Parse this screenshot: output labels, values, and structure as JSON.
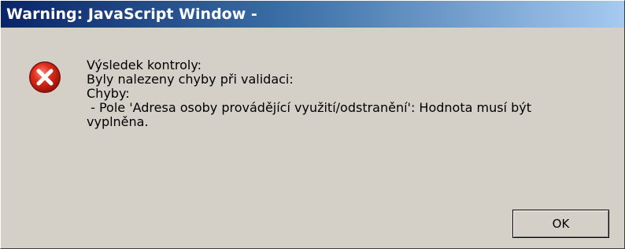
{
  "window": {
    "title": "Warning: JavaScript Window -"
  },
  "dialog": {
    "icon": "error-x-icon",
    "lines": [
      "Výsledek kontroly:",
      "Byly nalezeny chyby při validaci:",
      "Chyby:",
      " - Pole 'Adresa osoby provádějící využití/odstranění': Hodnota musí být",
      "vyplněna."
    ],
    "ok_label": "OK"
  },
  "colors": {
    "title_gradient_start": "#0a246a",
    "title_gradient_end": "#a6caf0",
    "dialog_background": "#d4d0c8",
    "error_icon_red": "#d42a1a"
  }
}
